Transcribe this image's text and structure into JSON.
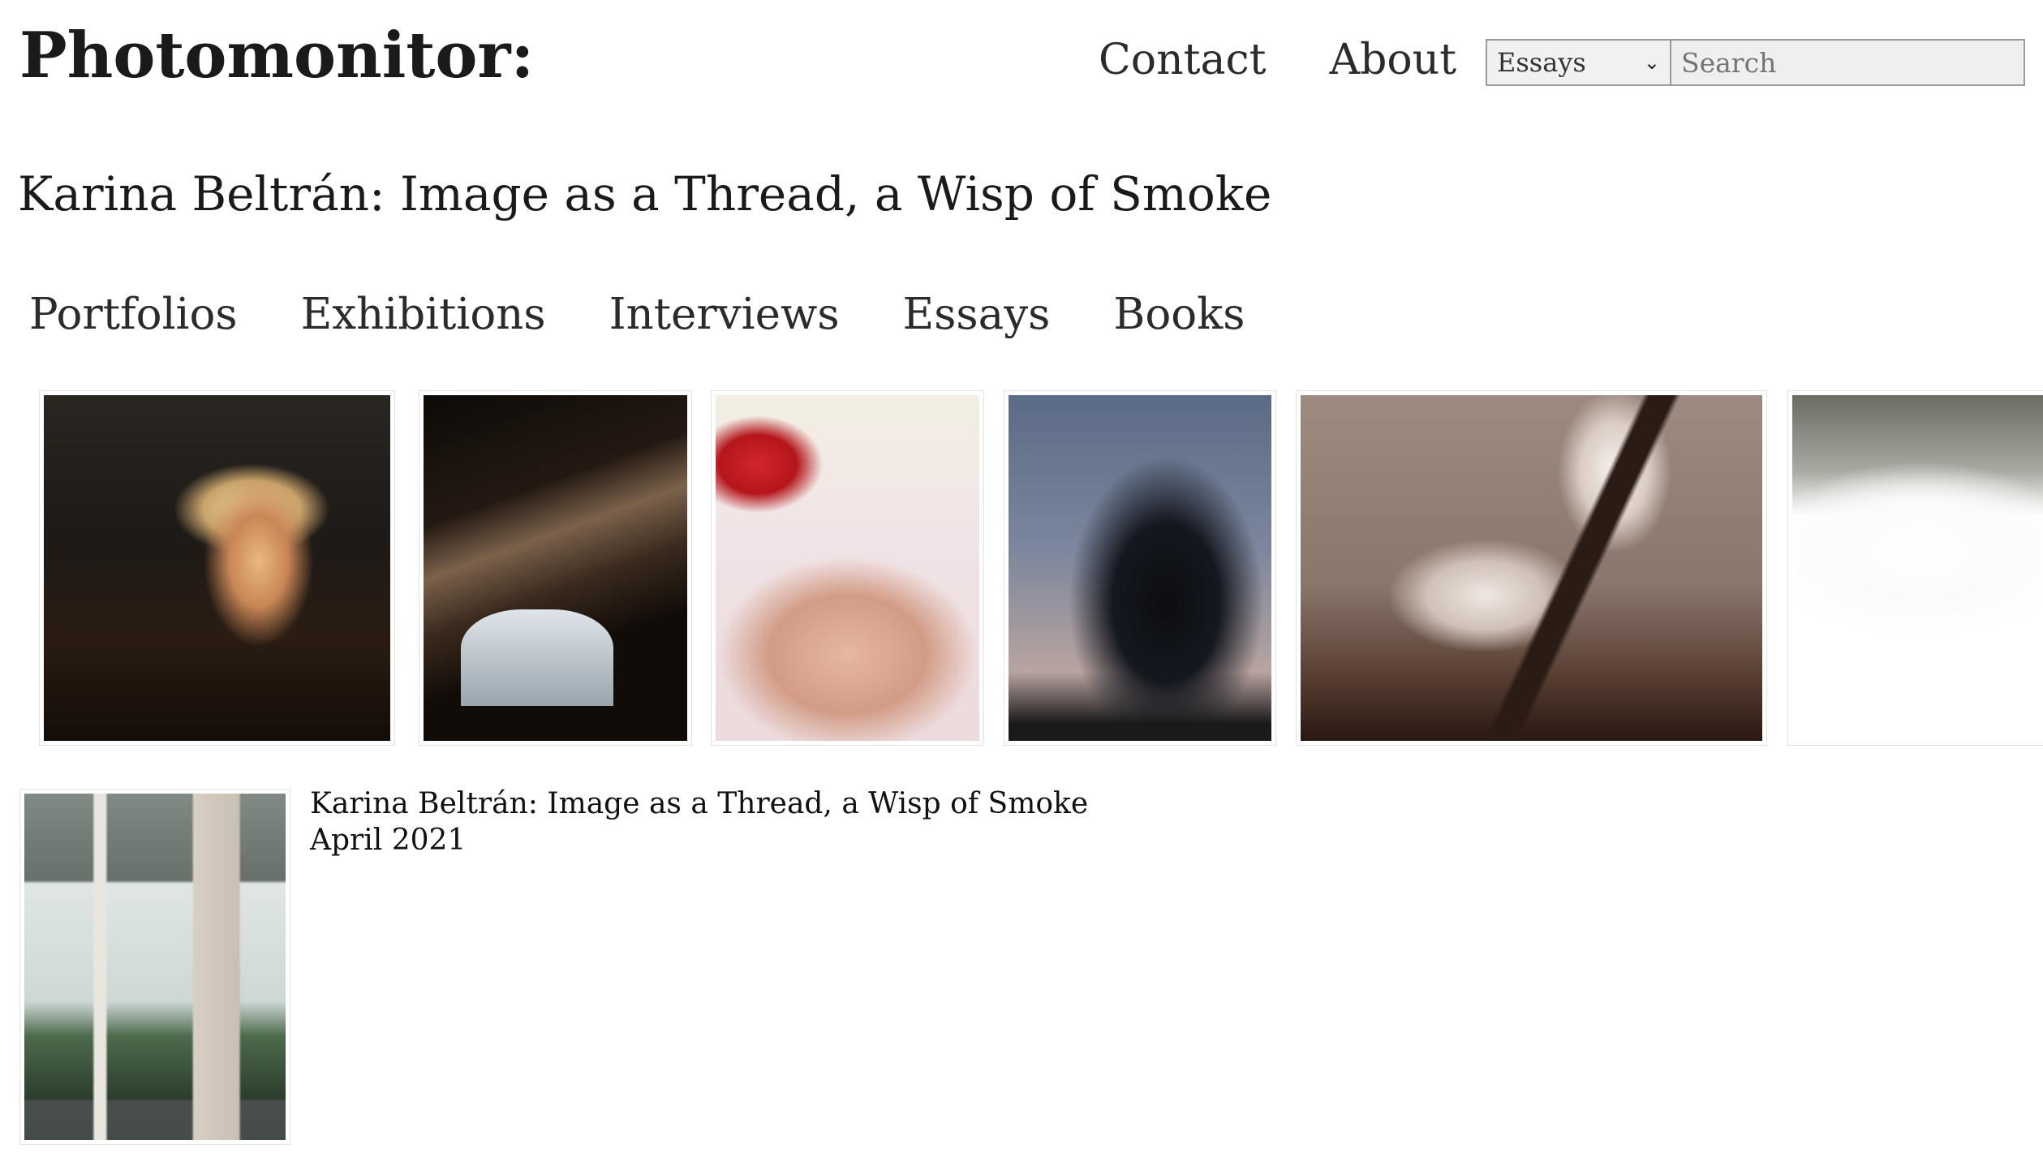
{
  "site": {
    "logo": "Photomonitor:"
  },
  "topnav": {
    "items": [
      "Contact",
      "About"
    ]
  },
  "search": {
    "category_selected": "Essays",
    "placeholder": "Search"
  },
  "article": {
    "title": "Karina Beltrán: Image as a Thread, a Wisp of Smoke"
  },
  "categories": [
    "Portfolios",
    "Exhibitions",
    "Interviews",
    "Essays",
    "Books"
  ],
  "gallery": {
    "thumbnails": [
      "photo-woman-night-city",
      "photo-mirror-dark-room",
      "photo-red-hair-clip-shirt",
      "photo-tree-silhouette-dusk",
      "photo-sunlit-cushions",
      "photo-overexposed-light"
    ]
  },
  "feature": {
    "title": "Karina Beltrán: Image as a Thread, a Wisp of Smoke",
    "date": "April 2021"
  }
}
